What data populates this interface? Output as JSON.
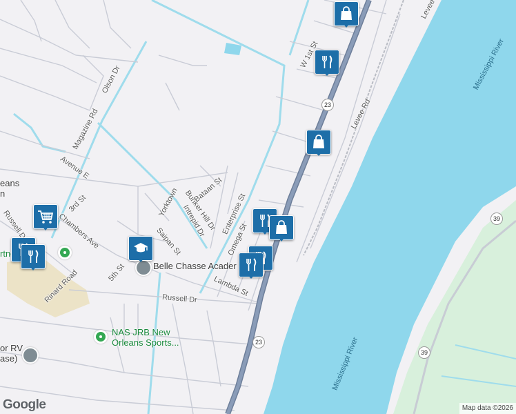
{
  "roads": {
    "w_1st": "W 1st St",
    "levee_top": "Levee",
    "levee_rd": "Levee Rd",
    "olson": "Olson Dr",
    "magazine": "Magazine Rd",
    "avenue_e": "Avenue E",
    "third": "3rd St",
    "chambers": "Chambers Ave",
    "russell_dr_left": "Russell Dr",
    "rinard": "Rinard Road",
    "fifth": "5th St",
    "saipan": "Saipan St",
    "intrepid": "Intrepid Dr",
    "bunker_hill": "Bunker Hill Dr",
    "bataan": "Bataan St",
    "yorktown": "Yorktown",
    "enterprise": "Enterprise St",
    "omega": "Omega St",
    "lambda": "Lambda St",
    "russell": "Russell Dr"
  },
  "place_labels": {
    "city_line1": "eans",
    "city_line2": "n",
    "partial_left": "rtne",
    "rv": "or RV",
    "rv2": "ase)",
    "academy": "Belle Chasse Acader",
    "nas_line1": "NAS JRB New",
    "nas_line2": "Orleans Sports..."
  },
  "water": {
    "river_east": "Mississippi River",
    "river_south": "Mississippi River"
  },
  "shields": {
    "hwy23_top": "23",
    "hwy23_bottom": "23",
    "hwy39_top": "39",
    "hwy39_bottom": "39"
  },
  "markers": [
    {
      "type": "shopping",
      "icon": "shopping-bag-icon"
    },
    {
      "type": "restaurant",
      "icon": "fork-knife-icon"
    },
    {
      "type": "shopping",
      "icon": "shopping-bag-icon"
    },
    {
      "type": "restaurant",
      "icon": "fork-knife-icon"
    },
    {
      "type": "shopping",
      "icon": "shopping-bag-icon"
    },
    {
      "type": "restaurant",
      "icon": "fork-knife-icon"
    },
    {
      "type": "restaurant",
      "icon": "fork-knife-icon"
    },
    {
      "type": "grocery",
      "icon": "shopping-cart-icon"
    },
    {
      "type": "restaurant",
      "icon": "fork-knife-icon"
    },
    {
      "type": "school",
      "icon": "graduation-cap-icon"
    }
  ],
  "colors": {
    "land": "#f2f1f4",
    "water": "#8fd7ec",
    "park": "#d8f0dc",
    "highway": "#8a9cb8",
    "marker": "#1d6ea8"
  },
  "branding": {
    "logo": "Google",
    "attribution": "Map data ©2026"
  }
}
